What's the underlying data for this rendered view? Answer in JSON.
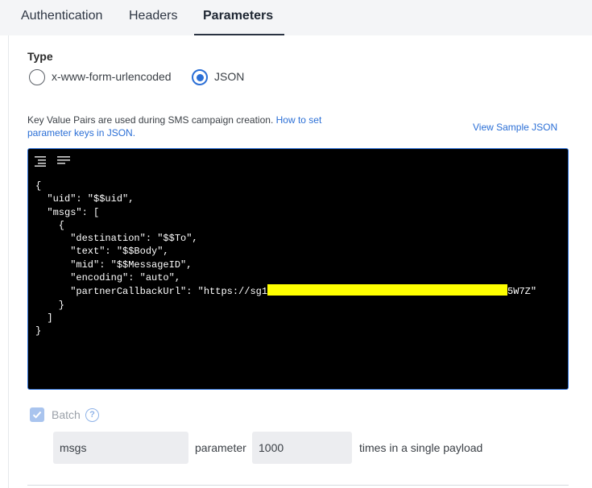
{
  "tabs": [
    {
      "label": "Authentication",
      "active": false
    },
    {
      "label": "Headers",
      "active": false
    },
    {
      "label": "Parameters",
      "active": true
    }
  ],
  "type_section": {
    "label": "Type",
    "options": [
      {
        "label": "x-www-form-urlencoded",
        "selected": false
      },
      {
        "label": "JSON",
        "selected": true
      }
    ]
  },
  "description": {
    "text": "Key Value Pairs are used during SMS campaign creation.",
    "link_text": "How to set parameter keys in JSON."
  },
  "view_sample_label": "View Sample JSON",
  "editor": {
    "icons": [
      "format-icon",
      "wrap-lines-icon"
    ],
    "lines": [
      "{",
      "  \"uid\": \"$$uid\",",
      "  \"msgs\": [",
      "    {",
      "      \"destination\": \"$$To\",",
      "      \"text\": \"$$Body\",",
      "      \"mid\": \"$$MessageID\",",
      "      \"encoding\": \"auto\",",
      "      \"partnerCallbackUrl\": \"https://sg1",
      "    }",
      "  ]",
      "}"
    ],
    "redacted_suffix": "5W7Z\""
  },
  "batch": {
    "label": "Batch",
    "checked": true,
    "help_glyph": "?",
    "param_value": "msgs",
    "parameter_text": "parameter",
    "count_value": "1000",
    "suffix_text": "times in a single payload"
  },
  "colors": {
    "accent": "#2b6fd6",
    "editor_bg": "#000000",
    "redaction": "#ffff00"
  }
}
